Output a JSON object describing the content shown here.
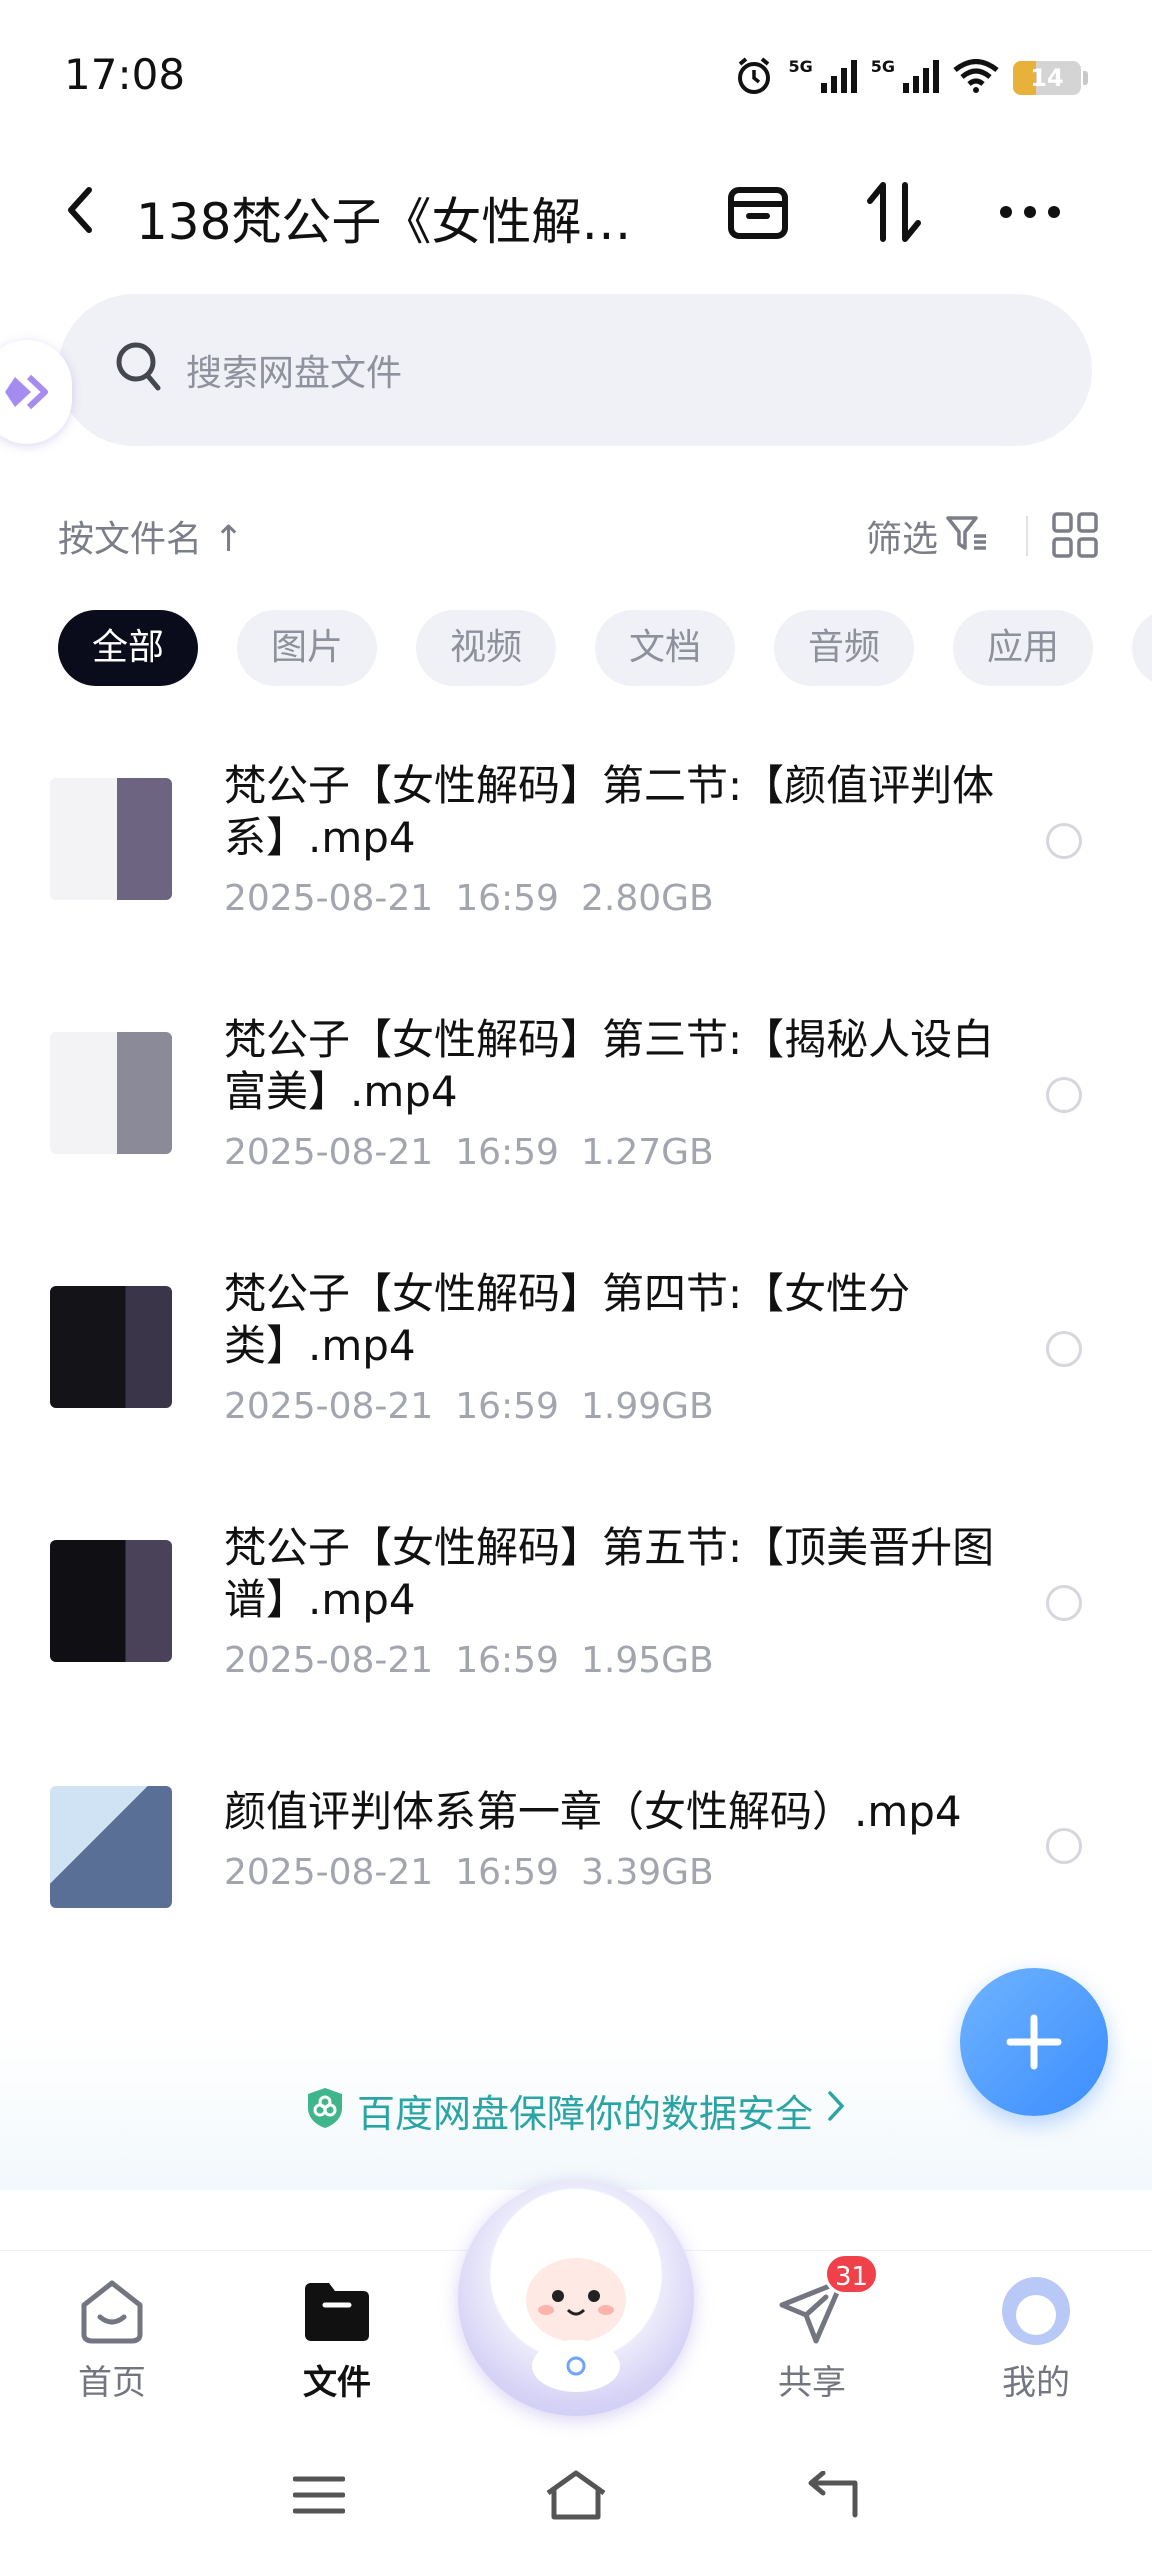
{
  "status_bar": {
    "time": "17:08",
    "battery_level": "14",
    "signal_1": "5G",
    "signal_2": "5G"
  },
  "header": {
    "title": "138梵公子《女性解…"
  },
  "search": {
    "placeholder": "搜索网盘文件"
  },
  "sort": {
    "label": "按文件名 ↑",
    "filter_label": "筛选"
  },
  "chips": [
    "全部",
    "图片",
    "视频",
    "文档",
    "音频",
    "应用"
  ],
  "files": [
    {
      "name": "梵公子【女性解码】第二节:【颜值评判体系】.mp4",
      "date": "2025-08-21",
      "time": "16:59",
      "size": "2.80GB"
    },
    {
      "name": "梵公子【女性解码】第三节:【揭秘人设白富美】.mp4",
      "date": "2025-08-21",
      "time": "16:59",
      "size": "1.27GB"
    },
    {
      "name": "梵公子【女性解码】第四节:【女性分类】.mp4",
      "date": "2025-08-21",
      "time": "16:59",
      "size": "1.99GB"
    },
    {
      "name": "梵公子【女性解码】第五节:【顶美晋升图谱】.mp4",
      "date": "2025-08-21",
      "time": "16:59",
      "size": "1.95GB"
    },
    {
      "name": "颜值评判体系第一章（女性解码）.mp4",
      "date": "2025-08-21",
      "time": "16:59",
      "size": "3.39GB"
    }
  ],
  "banner": {
    "text": "百度网盘保障你的数据安全"
  },
  "nav": {
    "home": "首页",
    "files": "文件",
    "share": "共享",
    "share_badge": "31",
    "me": "我的"
  },
  "colors": {
    "accent": "#3b8dff",
    "banner": "#2aa4a4",
    "badge": "#f0414a",
    "chip_active": "#0b0c1b"
  }
}
